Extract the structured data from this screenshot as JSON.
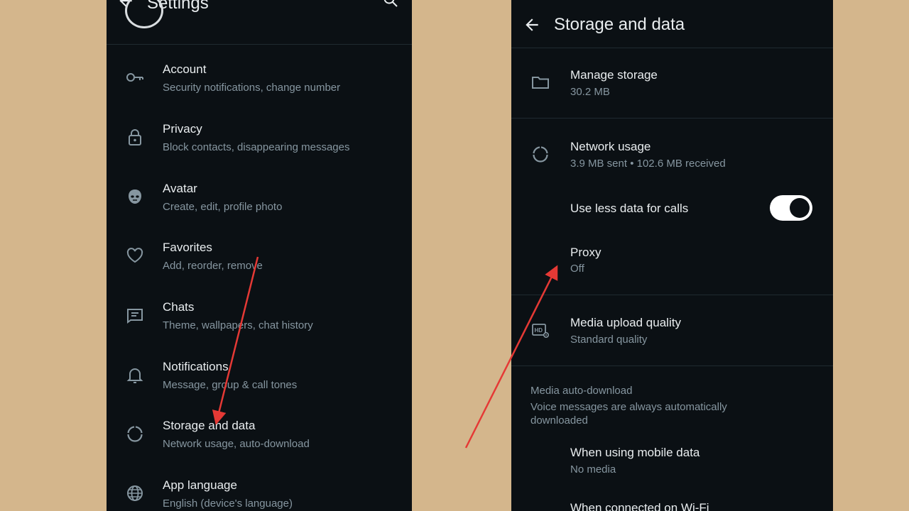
{
  "left_screen": {
    "header_title": "Settings",
    "items": [
      {
        "title": "Account",
        "subtitle": "Security notifications, change number",
        "icon": "key-icon"
      },
      {
        "title": "Privacy",
        "subtitle": "Block contacts, disappearing messages",
        "icon": "lock-icon"
      },
      {
        "title": "Avatar",
        "subtitle": "Create, edit, profile photo",
        "icon": "avatar-face-icon"
      },
      {
        "title": "Favorites",
        "subtitle": "Add, reorder, remove",
        "icon": "heart-icon"
      },
      {
        "title": "Chats",
        "subtitle": "Theme, wallpapers, chat history",
        "icon": "chat-icon"
      },
      {
        "title": "Notifications",
        "subtitle": "Message, group & call tones",
        "icon": "bell-icon"
      },
      {
        "title": "Storage and data",
        "subtitle": "Network usage, auto-download",
        "icon": "data-usage-icon"
      },
      {
        "title": "App language",
        "subtitle": "English (device's language)",
        "icon": "globe-icon"
      }
    ]
  },
  "right_screen": {
    "header_title": "Storage and data",
    "manage_storage": {
      "title": "Manage storage",
      "subtitle": "30.2 MB",
      "icon": "folder-icon"
    },
    "network_usage": {
      "title": "Network usage",
      "subtitle": "3.9 MB sent • 102.6 MB received",
      "icon": "data-usage-icon"
    },
    "use_less_data": {
      "title": "Use less data for calls",
      "toggle_on": true
    },
    "proxy": {
      "title": "Proxy",
      "subtitle": "Off"
    },
    "media_upload": {
      "title": "Media upload quality",
      "subtitle": "Standard quality",
      "icon": "hd-settings-icon"
    },
    "auto_download": {
      "heading": "Media auto-download",
      "description": "Voice messages are always automatically downloaded",
      "mobile_data": {
        "title": "When using mobile data",
        "subtitle": "No media"
      },
      "wifi": {
        "title": "When connected on Wi-Fi"
      }
    }
  },
  "colors": {
    "background": "#d4b68c",
    "screen": "#0b1014",
    "primary_text": "#e9edef",
    "secondary_text": "#8696a0",
    "annotation_arrow": "#e53935"
  }
}
